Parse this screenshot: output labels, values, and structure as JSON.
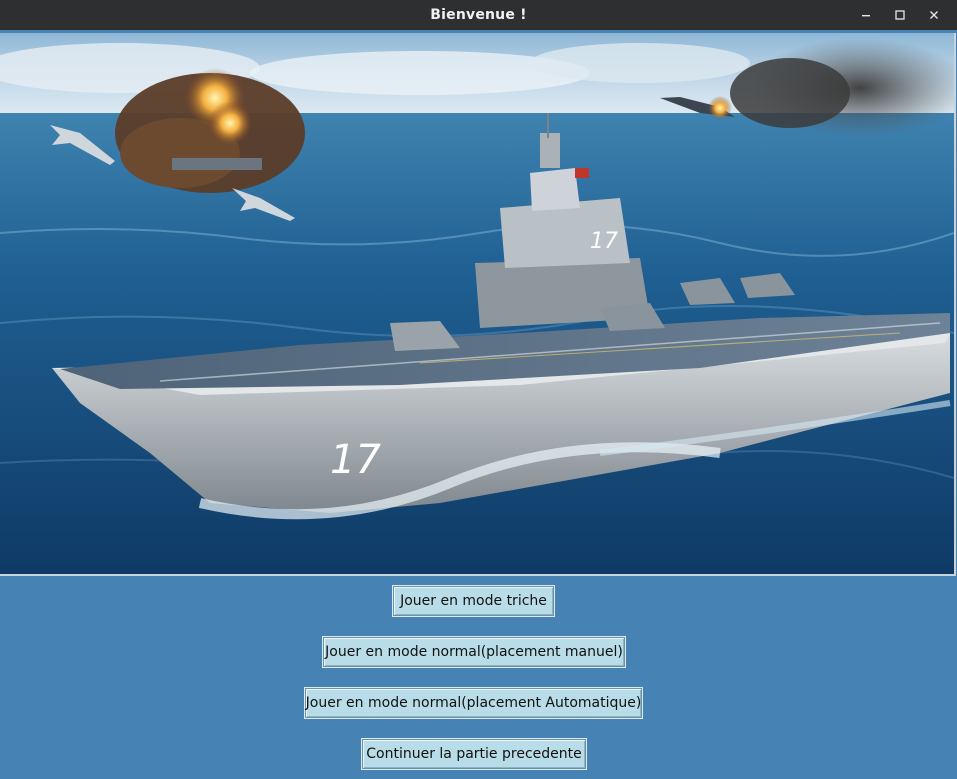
{
  "window": {
    "title": "Bienvenue !",
    "controls": {
      "minimize_icon": "minimize-icon",
      "maximize_icon": "maximize-icon",
      "close_icon": "close-icon"
    }
  },
  "banner": {
    "hull_number": "17"
  },
  "menu": {
    "buttons": [
      {
        "label": "Jouer en mode triche"
      },
      {
        "label": "Jouer en mode normal(placement manuel)"
      },
      {
        "label": "Jouer en mode normal(placement Automatique)"
      },
      {
        "label": "Continuer la partie precedente"
      }
    ]
  },
  "colors": {
    "background": "#4682b4",
    "titlebar": "#2d2f31",
    "button": "#b9dde8"
  }
}
